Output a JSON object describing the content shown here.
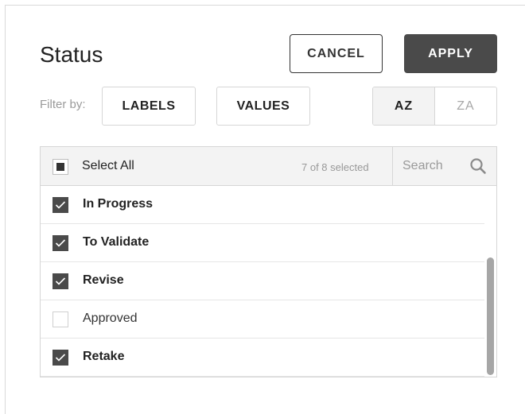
{
  "header": {
    "title": "Status",
    "cancel_label": "CANCEL",
    "apply_label": "APPLY"
  },
  "filter": {
    "label": "Filter by:",
    "labels_button": "LABELS",
    "values_button": "VALUES",
    "sort_az": "AZ",
    "sort_za": "ZA",
    "active_sort": "AZ"
  },
  "list": {
    "select_all_label": "Select All",
    "select_all_state": "indeterminate",
    "selected_count": "7 of 8 selected",
    "search_placeholder": "Search",
    "search_value": "",
    "items": [
      {
        "label": "In Progress",
        "checked": true
      },
      {
        "label": "To Validate",
        "checked": true
      },
      {
        "label": "Revise",
        "checked": true
      },
      {
        "label": "Approved",
        "checked": false
      },
      {
        "label": "Retake",
        "checked": true
      }
    ]
  },
  "colors": {
    "accent_dark": "#4a4a4a",
    "border": "#d6d6d6",
    "header_bg": "#f3f3f3",
    "muted_text": "#9a9a9a"
  }
}
